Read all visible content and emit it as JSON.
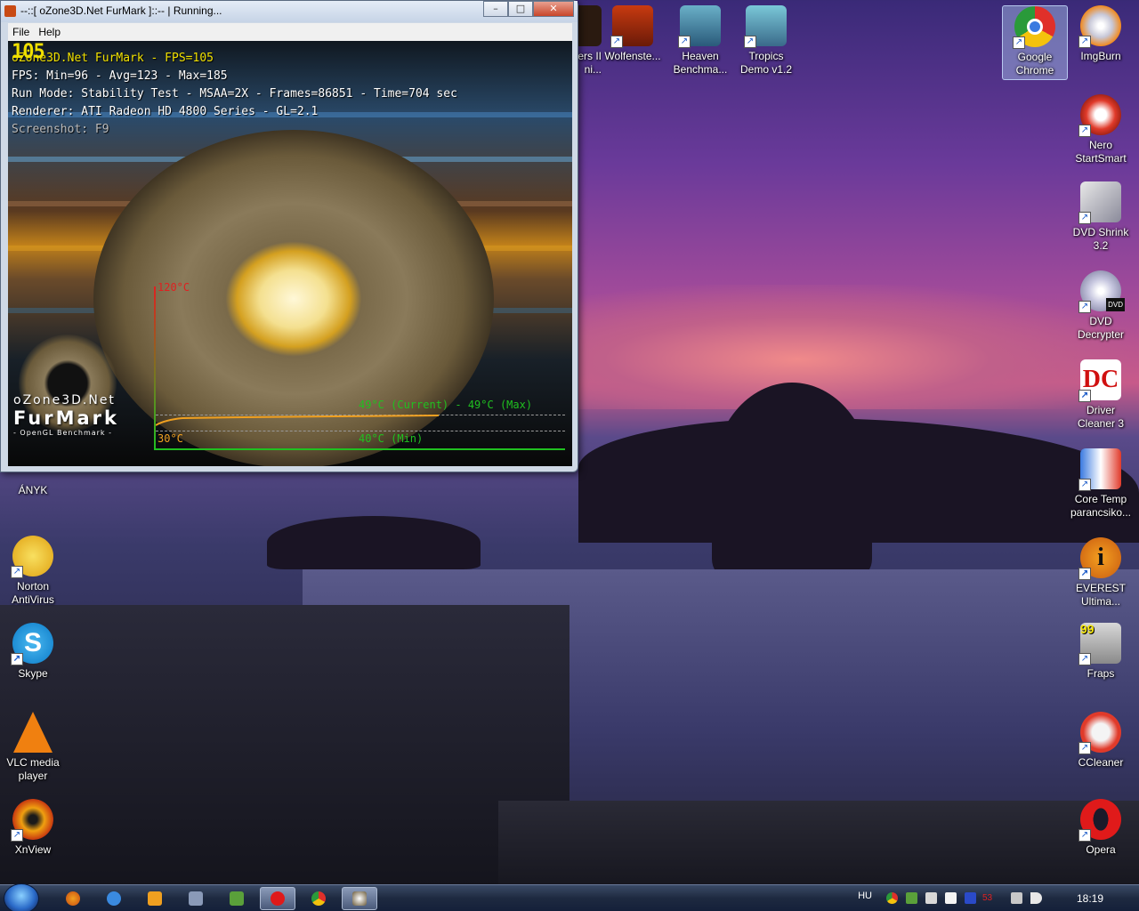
{
  "window": {
    "title": "--::[ oZone3D.Net FurMark ]::-- | Running...",
    "controls": {
      "minimize": "–",
      "maximize": "□",
      "close": "✕"
    },
    "menu": [
      "File",
      "Help"
    ]
  },
  "hud": {
    "fraps_counter": "105",
    "line1": "oZone3D.Net FurMark - FPS=105",
    "line2": "FPS: Min=96 - Avg=123 - Max=185",
    "line3": "Run Mode: Stability Test - MSAA=2X - Frames=86851 - Time=704 sec",
    "line4": "Renderer: ATI Radeon HD 4800 Series - GL=2.1",
    "line5": "Screenshot: F9"
  },
  "logo": {
    "top": "oZone3D.Net",
    "main": "FurMark",
    "sub": "- OpenGL Benchmark -"
  },
  "temperature_graph": {
    "max_label": "120°C",
    "min_label": "30°C",
    "current_label": "49°C (Current) - 49°C (Max)",
    "min_reading_label": "40°C (Min)",
    "colors": {
      "line": "#f0a020",
      "text": "#20c020",
      "max": "#e02020"
    }
  },
  "desktop_icons": {
    "partial": {
      "label": "ers II\nni..."
    },
    "wolfenstein": {
      "label": "Wolfenste..."
    },
    "heaven": {
      "label": "Heaven Benchma..."
    },
    "tropics": {
      "label": "Tropics Demo v1.2"
    },
    "chrome": {
      "label": "Google Chrome"
    },
    "imgburn": {
      "label": "ImgBurn"
    },
    "nero": {
      "label": "Nero StartSmart"
    },
    "dvdshrink": {
      "label": "DVD Shrink 3.2"
    },
    "dvddecrypter": {
      "label": "DVD Decrypter",
      "badge": "DVD"
    },
    "drivercleaner": {
      "label": "Driver Cleaner 3"
    },
    "coretemp": {
      "label": "Core Temp parancsiko..."
    },
    "everest": {
      "label": "EVEREST Ultima..."
    },
    "fraps": {
      "label": "Fraps",
      "badge": "99"
    },
    "ccleaner": {
      "label": "CCleaner"
    },
    "opera": {
      "label": "Opera"
    },
    "anyk": {
      "label": "ÁNYK"
    },
    "norton": {
      "label": "Norton AntiVirus"
    },
    "skype": {
      "label": "Skype"
    },
    "vlc": {
      "label": "VLC media player"
    },
    "xnview": {
      "label": "XnView"
    }
  },
  "taskbar": {
    "language": "HU",
    "clock": "18:19",
    "tray_number": "53"
  }
}
